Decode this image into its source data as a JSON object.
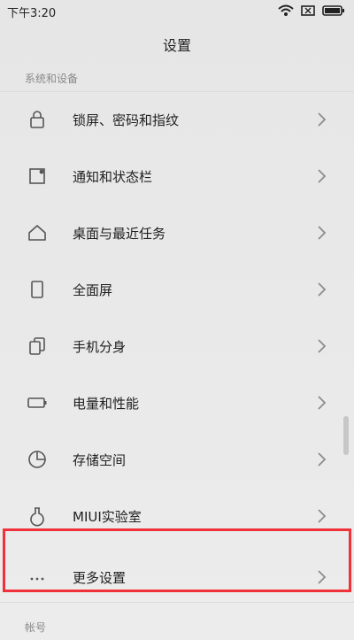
{
  "status_bar": {
    "time": "下午3:20",
    "icons": [
      "wifi-icon",
      "battery-x-icon",
      "battery-icon"
    ]
  },
  "app_bar": {
    "title": "设置"
  },
  "sections": [
    {
      "header": "系统和设备",
      "items": [
        {
          "label": "锁屏、密码和指纹",
          "icon": "lock-icon"
        },
        {
          "label": "通知和状态栏",
          "icon": "notification-icon"
        },
        {
          "label": "桌面与最近任务",
          "icon": "home-icon"
        },
        {
          "label": "全面屏",
          "icon": "phone-screen-icon"
        },
        {
          "label": "手机分身",
          "icon": "dual-phone-icon"
        },
        {
          "label": "电量和性能",
          "icon": "battery-icon"
        },
        {
          "label": "存储空间",
          "icon": "storage-pie-icon"
        },
        {
          "label": "MIUI实验室",
          "icon": "flask-icon"
        },
        {
          "label": "更多设置",
          "icon": "more-dots-icon"
        }
      ]
    },
    {
      "header": "帐号",
      "items": []
    }
  ],
  "colors": {
    "highlight_border": "#f0313a",
    "background": "#e9e9e9"
  }
}
